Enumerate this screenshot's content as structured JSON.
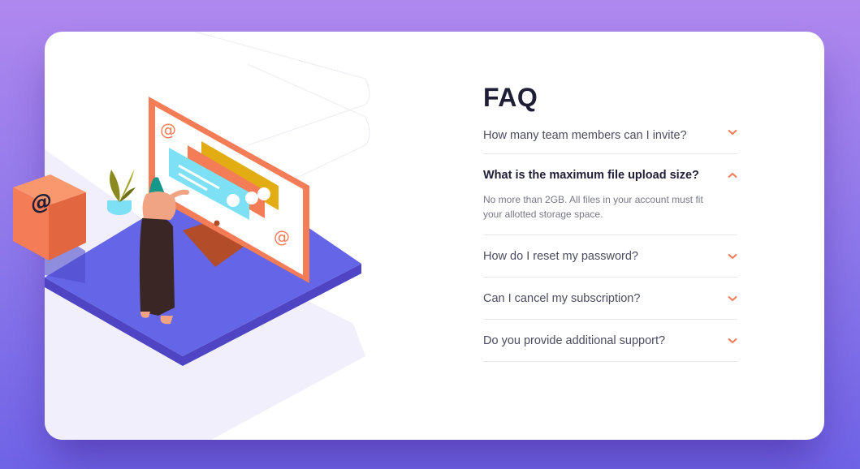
{
  "faq": {
    "title": "FAQ",
    "items": [
      {
        "question": "How many team members can I invite?",
        "expanded": false,
        "icon": "chevron-down-icon"
      },
      {
        "question": "What is the maximum file upload size?",
        "expanded": true,
        "icon": "chevron-up-icon",
        "answer": "No more than 2GB. All files in your account must fit your allotted storage space."
      },
      {
        "question": "How do I reset my password?",
        "expanded": false,
        "icon": "chevron-down-icon"
      },
      {
        "question": "Can I cancel my subscription?",
        "expanded": false,
        "icon": "chevron-down-icon"
      },
      {
        "question": "Do you provide additional support?",
        "expanded": false,
        "icon": "chevron-down-icon"
      }
    ]
  },
  "illustration": {
    "box_symbol": "@",
    "screen_symbols": [
      "@",
      "@"
    ]
  },
  "colors": {
    "accent": "#f47c57",
    "heading": "#1e1f36",
    "text": "#4b4c5f",
    "muted": "#787887",
    "platform": "#6565e7",
    "background_top": "#af88ee",
    "background_bottom": "#6f63e6"
  }
}
